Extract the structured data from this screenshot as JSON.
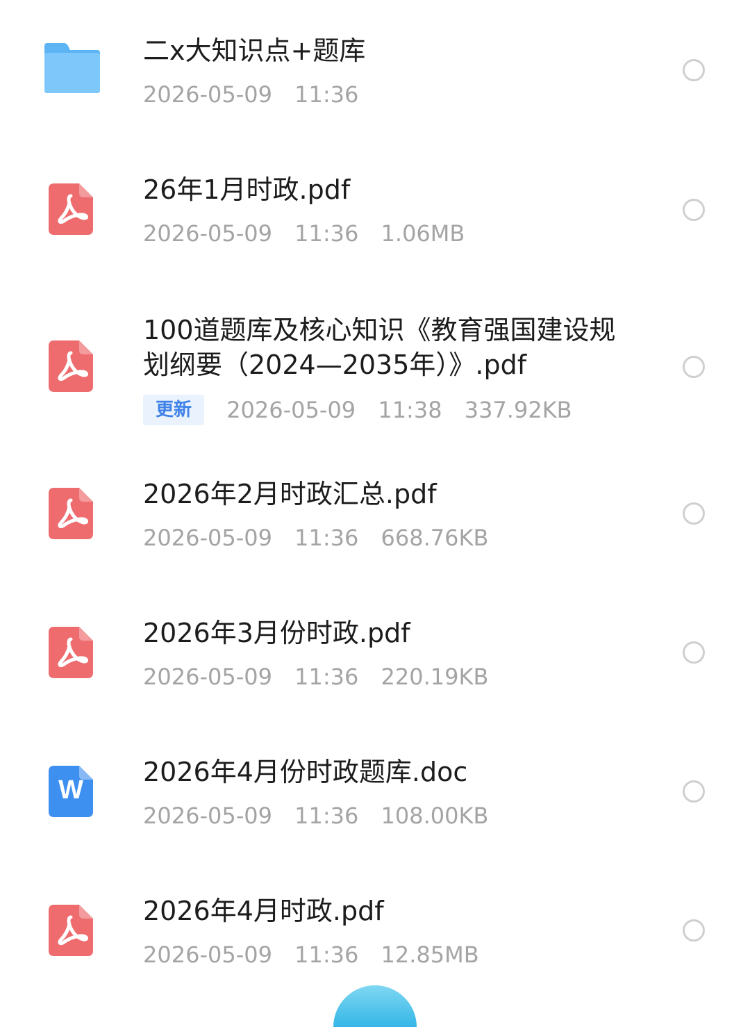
{
  "files": [
    {
      "name": "二x大知识点+题库",
      "type": "folder",
      "icon": "folder-icon",
      "date": "2026-05-09",
      "time": "11:36",
      "size": ""
    },
    {
      "name": "26年1月时政.pdf",
      "type": "pdf",
      "icon": "pdf-icon",
      "date": "2026-05-09",
      "time": "11:36",
      "size": "1.06MB"
    },
    {
      "name": "100道题库及核心知识《教育强国建设规划纲要（2024—2035年）》.pdf",
      "type": "pdf",
      "icon": "pdf-icon",
      "badge": "更新",
      "date": "2026-05-09",
      "time": "11:38",
      "size": "337.92KB"
    },
    {
      "name": "2026年2月时政汇总.pdf",
      "type": "pdf",
      "icon": "pdf-icon",
      "date": "2026-05-09",
      "time": "11:36",
      "size": "668.76KB"
    },
    {
      "name": "2026年3月份时政.pdf",
      "type": "pdf",
      "icon": "pdf-icon",
      "date": "2026-05-09",
      "time": "11:36",
      "size": "220.19KB"
    },
    {
      "name": "2026年4月份时政题库.doc",
      "type": "doc",
      "icon": "word-icon",
      "date": "2026-05-09",
      "time": "11:36",
      "size": "108.00KB"
    },
    {
      "name": "2026年4月时政.pdf",
      "type": "pdf",
      "icon": "pdf-icon",
      "date": "2026-05-09",
      "time": "11:36",
      "size": "12.85MB"
    }
  ],
  "colors": {
    "pdf": "#ee6b6e",
    "word": "#3d8ff0",
    "folder": "#5db4f5",
    "meta_text": "#a4a4a4",
    "badge_text": "#3f82e8",
    "badge_bg": "#eaf2fd"
  },
  "word_letter": "W"
}
